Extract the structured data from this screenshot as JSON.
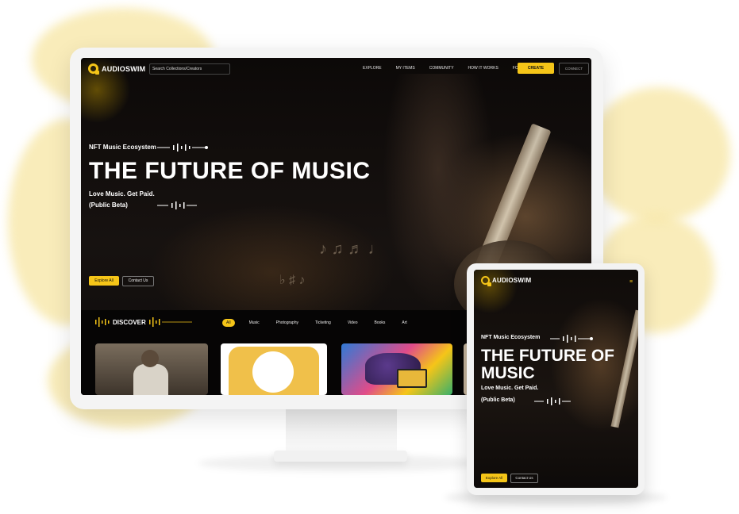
{
  "brand": {
    "name": "AUDIOSWIM",
    "accent": "#f5c518"
  },
  "desktop": {
    "search_placeholder": "Search Collections/Creators",
    "nav_links": [
      "EXPLORE",
      "MY ITEMS",
      "COMMUNITY",
      "HOW IT WORKS",
      "FOLLOWING"
    ],
    "create_label": "CREATE",
    "connect_label": "CONNECT",
    "eyebrow": "NFT Music Ecosystem",
    "title": "THE FUTURE OF MUSIC",
    "tagline1": "Love Music. Get Paid.",
    "tagline2": "(Public Beta)",
    "explore_label": "Explore All",
    "contact_label": "Contact Us",
    "discover_label": "DISCOVER",
    "filters": [
      "All",
      "Music",
      "Photography",
      "Ticketing",
      "Video",
      "Books",
      "Art"
    ]
  },
  "tablet": {
    "menu_icon": "hamburger-icon",
    "eyebrow": "NFT Music Ecosystem",
    "title": "THE FUTURE OF MUSIC",
    "tagline1": "Love Music. Get Paid.",
    "tagline2": "(Public Beta)",
    "explore_label": "Explore All",
    "contact_label": "Contact Us"
  }
}
